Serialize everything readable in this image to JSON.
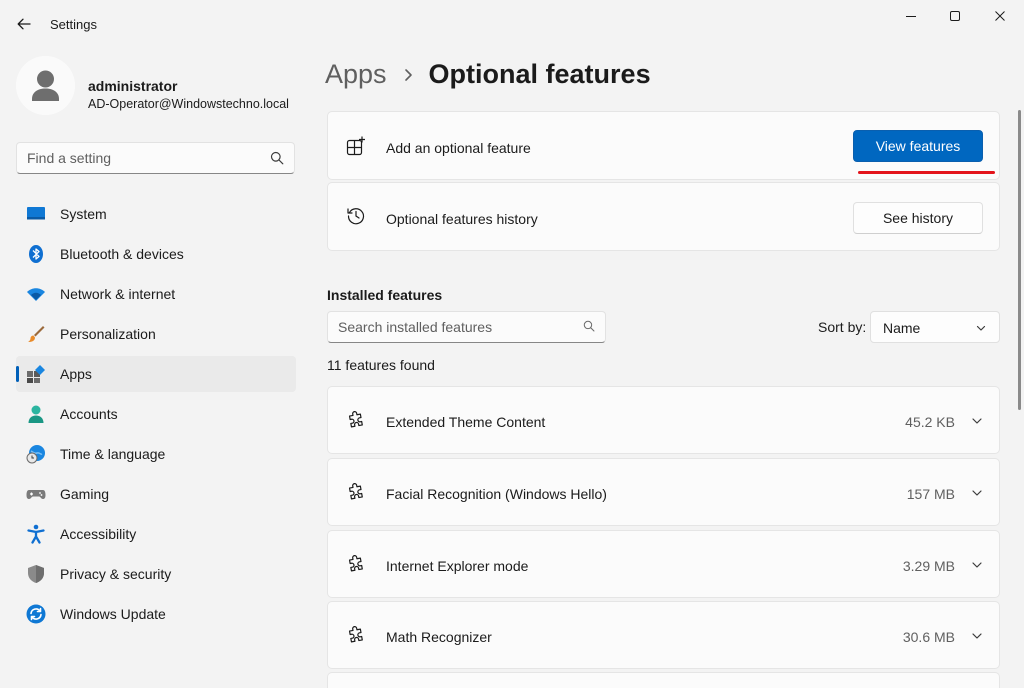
{
  "window": {
    "title": "Settings"
  },
  "profile": {
    "name": "administrator",
    "email": "AD-Operator@Windowstechno.local"
  },
  "search": {
    "placeholder": "Find a setting"
  },
  "nav": {
    "items": [
      {
        "label": "System",
        "icon": "system-icon"
      },
      {
        "label": "Bluetooth & devices",
        "icon": "bluetooth-icon"
      },
      {
        "label": "Network & internet",
        "icon": "wifi-icon"
      },
      {
        "label": "Personalization",
        "icon": "brush-icon"
      },
      {
        "label": "Apps",
        "icon": "apps-icon",
        "active": true
      },
      {
        "label": "Accounts",
        "icon": "person-icon"
      },
      {
        "label": "Time & language",
        "icon": "globe-clock-icon"
      },
      {
        "label": "Gaming",
        "icon": "gamepad-icon"
      },
      {
        "label": "Accessibility",
        "icon": "accessibility-icon"
      },
      {
        "label": "Privacy & security",
        "icon": "shield-icon"
      },
      {
        "label": "Windows Update",
        "icon": "update-icon"
      }
    ]
  },
  "breadcrumb": {
    "parent": "Apps",
    "current": "Optional features"
  },
  "add_feature": {
    "label": "Add an optional feature",
    "button": "View features"
  },
  "history": {
    "label": "Optional features history",
    "button": "See history"
  },
  "installed": {
    "title": "Installed features",
    "search_placeholder": "Search installed features",
    "sort_label": "Sort by:",
    "sort_value": "Name",
    "count": "11 features found",
    "features": [
      {
        "name": "Extended Theme Content",
        "size": "45.2 KB"
      },
      {
        "name": "Facial Recognition (Windows Hello)",
        "size": "157 MB"
      },
      {
        "name": "Internet Explorer mode",
        "size": "3.29 MB"
      },
      {
        "name": "Math Recognizer",
        "size": "30.6 MB"
      }
    ]
  },
  "colors": {
    "accent": "#0067c0",
    "highlight_underline": "#e3141b",
    "background": "#f3f3f3"
  }
}
